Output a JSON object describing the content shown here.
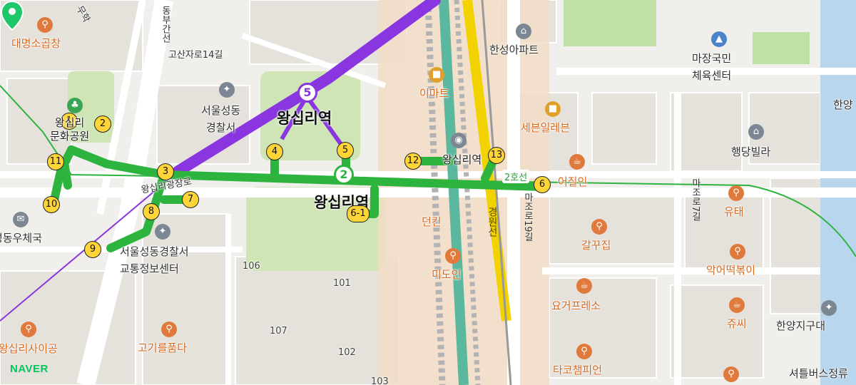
{
  "brand": {
    "logo": "NAVER",
    "color": "#03c75a"
  },
  "colors": {
    "line2": "#2db43f",
    "line5": "#8936e0",
    "route": "#2db43f",
    "poi": "#d9691f",
    "rail_yellow": "#f2d300",
    "rail_teal": "#5bb89e"
  },
  "stations": {
    "main_label": "왕십리역",
    "subway_label": "왕십리역",
    "line2_badge": "2",
    "line5_badge": "5",
    "line2_tag": "2호선",
    "line5_label": "왕십리역"
  },
  "exits": [
    "1",
    "2",
    "3",
    "4",
    "5",
    "6",
    "6-1",
    "7",
    "8",
    "9",
    "10",
    "11",
    "12",
    "13"
  ],
  "roads": {
    "gosanja_14": "고산자로14길",
    "wangsimni_plaza": "왕십리광장로",
    "majo_19": "마조로19길",
    "majo_7": "마조로7길",
    "dongbu": "동부간선",
    "muhak": "무학",
    "rail_label": "경원선"
  },
  "places": {
    "daemyeong": "대명소곱창",
    "munhwa_park": "왕십리\n문화공원",
    "police_station": "서울성동\n경찰서",
    "hansung_apt": "한성아파트",
    "emart": "이마트",
    "majang_gym": "마장국민\n체육센터",
    "seven_eleven": "세븐일레븐",
    "haengdang_villa": "행당빌라",
    "eojilin": "어질인",
    "yutae": "유태",
    "dunkin": "던킨",
    "mido_in": "미도인",
    "galggujip": "갈꾸집",
    "eoeo_tteok": "악어떡볶이",
    "yogurpresso": "요거프레소",
    "jussi": "쥬씨",
    "taco_champion": "타코챔피언",
    "setteul_bus": "셔틀버스정류",
    "hanyang_district": "한양지구대",
    "hanyang": "한양",
    "post_office": "성동우체국",
    "traffic_center": "서울성동경찰서\n교통정보센터",
    "wangsimni_sagong": "왕십리사이공",
    "gogireul_pumda": "고기를품다"
  },
  "building_numbers": [
    "106",
    "101",
    "107",
    "102",
    "103"
  ],
  "icons": [
    "restaurant-icon",
    "cafe-icon",
    "building-icon",
    "police-icon",
    "gym-icon",
    "park-icon",
    "store-icon",
    "subway-icon",
    "location-pin-icon"
  ]
}
